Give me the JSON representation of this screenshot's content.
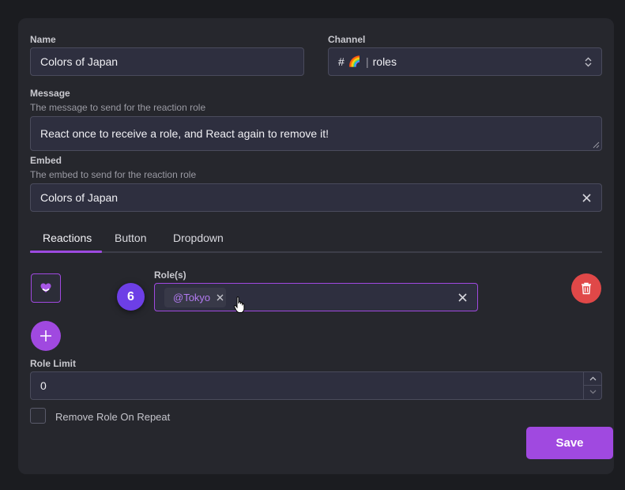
{
  "form": {
    "name": {
      "label": "Name",
      "value": "Colors of Japan"
    },
    "channel": {
      "label": "Channel",
      "hash": "#",
      "emoji": "🌈",
      "sep": "|",
      "value": "roles"
    },
    "message": {
      "label": "Message",
      "hint": "The message to send for the reaction role",
      "value": "React once to receive a role, and React again to remove it!"
    },
    "embed": {
      "label": "Embed",
      "hint": "The embed to send for the reaction role",
      "value": "Colors of Japan"
    }
  },
  "tabs": [
    "Reactions",
    "Button",
    "Dropdown"
  ],
  "reaction": {
    "emoji_icon": "purple-heart-icon",
    "step_badge": "6",
    "roles_label": "Role(s)",
    "role_chip": "@Tokyo"
  },
  "role_limit": {
    "label": "Role Limit",
    "value": "0"
  },
  "remove_on_repeat": {
    "label": "Remove Role On Repeat",
    "checked": false
  },
  "save_label": "Save",
  "colors": {
    "accent": "#a049e0",
    "delete": "#e04848",
    "badge": "#7a3cf0"
  }
}
